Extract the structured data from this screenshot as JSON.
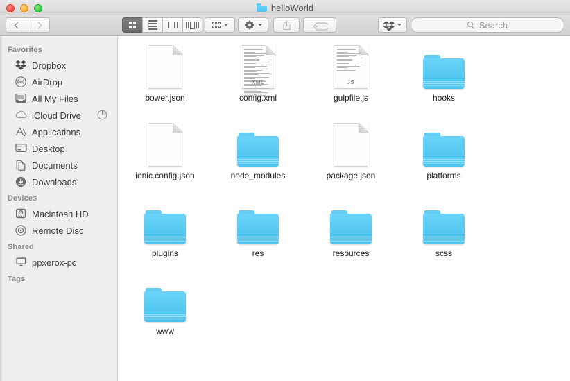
{
  "window": {
    "title": "helloWorld",
    "title_icon": "folder-icon",
    "traffic_lights": [
      {
        "name": "close-button",
        "color": "#f44336"
      },
      {
        "name": "minimize-button",
        "color": "#f5a623"
      },
      {
        "name": "maximize-button",
        "color": "#28c63c"
      }
    ]
  },
  "toolbar": {
    "back_label": "Back",
    "forward_label": "Forward",
    "view_modes": [
      {
        "name": "icon-view",
        "icon": "grid-icon",
        "active": true
      },
      {
        "name": "list-view",
        "icon": "list-icon",
        "active": false
      },
      {
        "name": "column-view",
        "icon": "columns-icon",
        "active": false
      },
      {
        "name": "gallery-view",
        "icon": "gallery-icon",
        "active": false
      }
    ],
    "arrange_label": "Arrange",
    "arrange_icon": "arrange-grid-icon",
    "action_label": "Action",
    "action_icon": "gear-icon",
    "share_label": "Share",
    "share_icon": "share-icon",
    "tag_label": "Tags",
    "tag_icon": "tag-icon",
    "dropbox_label": "Dropbox",
    "dropbox_icon": "dropbox-icon"
  },
  "search": {
    "placeholder": "Search",
    "value": "",
    "icon": "search-icon"
  },
  "sidebar": {
    "sections": [
      {
        "header": "Favorites",
        "items": [
          {
            "label": "Dropbox",
            "icon": "dropbox-icon"
          },
          {
            "label": "AirDrop",
            "icon": "airdrop-icon"
          },
          {
            "label": "All My Files",
            "icon": "all-my-files-icon"
          },
          {
            "label": "iCloud Drive",
            "icon": "icloud-icon",
            "badge": "sync-progress-icon"
          },
          {
            "label": "Applications",
            "icon": "applications-icon"
          },
          {
            "label": "Desktop",
            "icon": "desktop-icon"
          },
          {
            "label": "Documents",
            "icon": "documents-icon"
          },
          {
            "label": "Downloads",
            "icon": "downloads-icon"
          }
        ]
      },
      {
        "header": "Devices",
        "items": [
          {
            "label": "Macintosh HD",
            "icon": "hard-drive-icon"
          },
          {
            "label": "Remote Disc",
            "icon": "optical-disc-icon"
          }
        ]
      },
      {
        "header": "Shared",
        "items": [
          {
            "label": "ppxerox-pc",
            "icon": "computer-icon"
          }
        ]
      },
      {
        "header": "Tags",
        "items": []
      }
    ]
  },
  "files": [
    {
      "name": "bower.json",
      "type": "file",
      "kind": ""
    },
    {
      "name": "config.xml",
      "type": "file",
      "kind": "XML"
    },
    {
      "name": "gulpfile.js",
      "type": "file",
      "kind": "JS"
    },
    {
      "name": "hooks",
      "type": "folder",
      "kind": ""
    },
    {
      "name": "ionic.config.json",
      "type": "file",
      "kind": ""
    },
    {
      "name": "node_modules",
      "type": "folder",
      "kind": ""
    },
    {
      "name": "package.json",
      "type": "file",
      "kind": ""
    },
    {
      "name": "platforms",
      "type": "folder",
      "kind": ""
    },
    {
      "name": "plugins",
      "type": "folder",
      "kind": ""
    },
    {
      "name": "res",
      "type": "folder",
      "kind": ""
    },
    {
      "name": "resources",
      "type": "folder",
      "kind": ""
    },
    {
      "name": "scss",
      "type": "folder",
      "kind": ""
    },
    {
      "name": "www",
      "type": "folder",
      "kind": ""
    }
  ],
  "colors": {
    "folder_blue": "#4fc6f2",
    "sidebar_bg": "#f0eeee",
    "toolbar_bg": "#d8d6d6",
    "content_bg": "#ffffff",
    "accent_active": "#6d6b6b"
  }
}
